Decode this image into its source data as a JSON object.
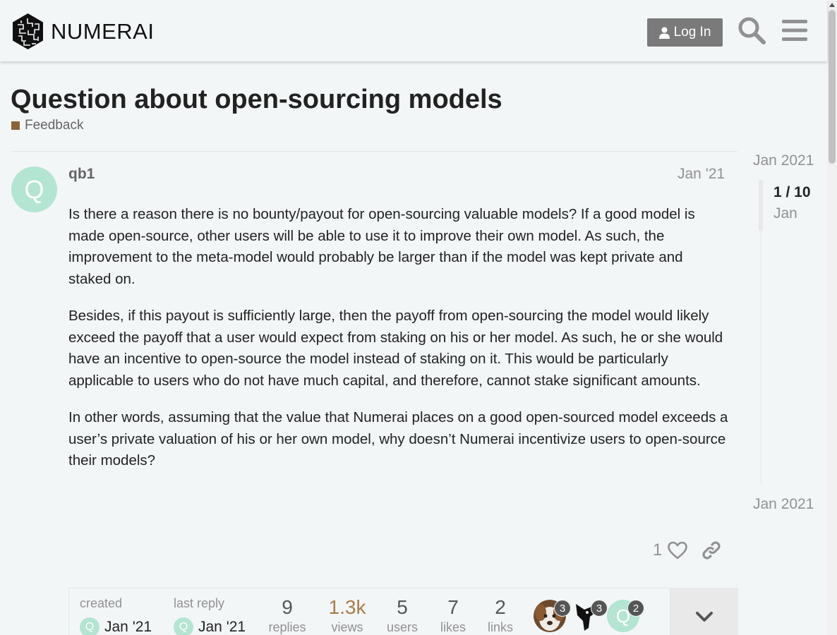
{
  "header": {
    "logo_text": "NUMERAI",
    "login_label": "Log In"
  },
  "topic": {
    "title": "Question about open-sourcing models",
    "category": "Feedback",
    "category_color": "#8c6238"
  },
  "post": {
    "avatar_letter": "Q",
    "avatar_color": "#b3e5d2",
    "username": "qb1",
    "date": "Jan '21",
    "paragraphs": [
      "Is there a reason there is no bounty/payout for open-sourcing valuable models? If a good model is made open-source, other users will be able to use it to improve their own model. As such, the improvement to the meta-model would probably be larger than if the model was kept private and staked on.",
      "Besides, if this payout is sufficiently large, then the payoff from open-sourcing the model would likely exceed the payoff that a user would expect from staking on his or her model. As such, he or she would have an incentive to open-source the model instead of staking on it. This would be particularly applicable to users who do not have much capital, and therefore, cannot stake significant amounts.",
      "In other words, assuming that the value that Numerai places on a good open-sourced model exceeds a user’s private valuation of his or her own model, why doesn’t Numerai incentivize users to open-source their models?"
    ],
    "like_count": "1"
  },
  "topic_map": {
    "created_label": "created",
    "created_avatar": "Q",
    "created_date": "Jan '21",
    "last_reply_label": "last reply",
    "last_reply_avatar": "Q",
    "last_reply_date": "Jan '21",
    "stats": [
      {
        "num": "9",
        "label": "replies"
      },
      {
        "num": "1.3k",
        "label": "views"
      },
      {
        "num": "5",
        "label": "users"
      },
      {
        "num": "7",
        "label": "likes"
      },
      {
        "num": "2",
        "label": "links"
      }
    ],
    "participants": [
      {
        "badge": "3"
      },
      {
        "badge": "3"
      },
      {
        "letter": "Q",
        "badge": "2"
      }
    ]
  },
  "timeline": {
    "top_date": "Jan 2021",
    "position": "1 / 10",
    "current_month": "Jan",
    "bottom_date": "Jan 2021"
  }
}
